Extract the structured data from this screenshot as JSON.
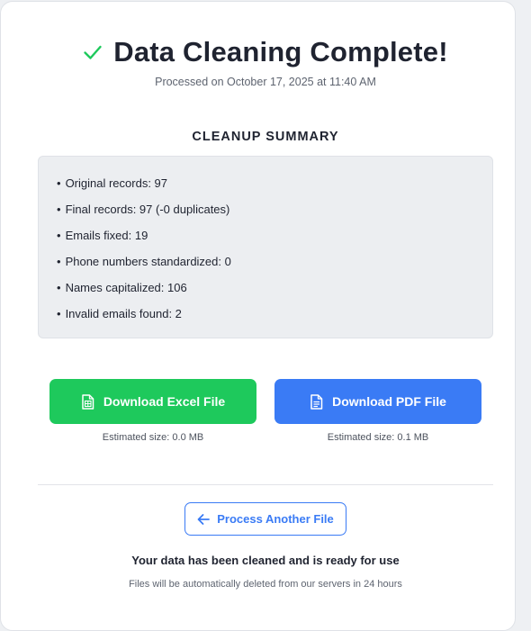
{
  "header": {
    "title": "Data Cleaning Complete!",
    "timestamp": "Processed on October 17, 2025 at 11:40 AM",
    "icon": "check-icon"
  },
  "summary": {
    "heading": "CLEANUP SUMMARY",
    "items": [
      "Original records: 97",
      "Final records: 97 (-0 duplicates)",
      "Emails fixed: 19",
      "Phone numbers standardized: 0",
      "Names capitalized: 106",
      "Invalid emails found: 2"
    ]
  },
  "downloads": {
    "excel": {
      "label": "Download Excel File",
      "size": "Estimated size: 0.0 MB",
      "icon": "spreadsheet-file-icon",
      "color": "#1ec95c"
    },
    "pdf": {
      "label": "Download PDF File",
      "size": "Estimated size: 0.1 MB",
      "icon": "document-file-icon",
      "color": "#3a7bf5"
    }
  },
  "actions": {
    "process_another_label": "Process Another File",
    "process_icon": "arrow-left-icon"
  },
  "footer": {
    "ready_message": "Your data has been cleaned and is ready for use",
    "delete_note": "Files will be automatically deleted from our servers in 24 hours"
  },
  "colors": {
    "success": "#1ec95c",
    "accent": "#3a7bf5",
    "text": "#1f2330",
    "muted": "#5e6470"
  }
}
